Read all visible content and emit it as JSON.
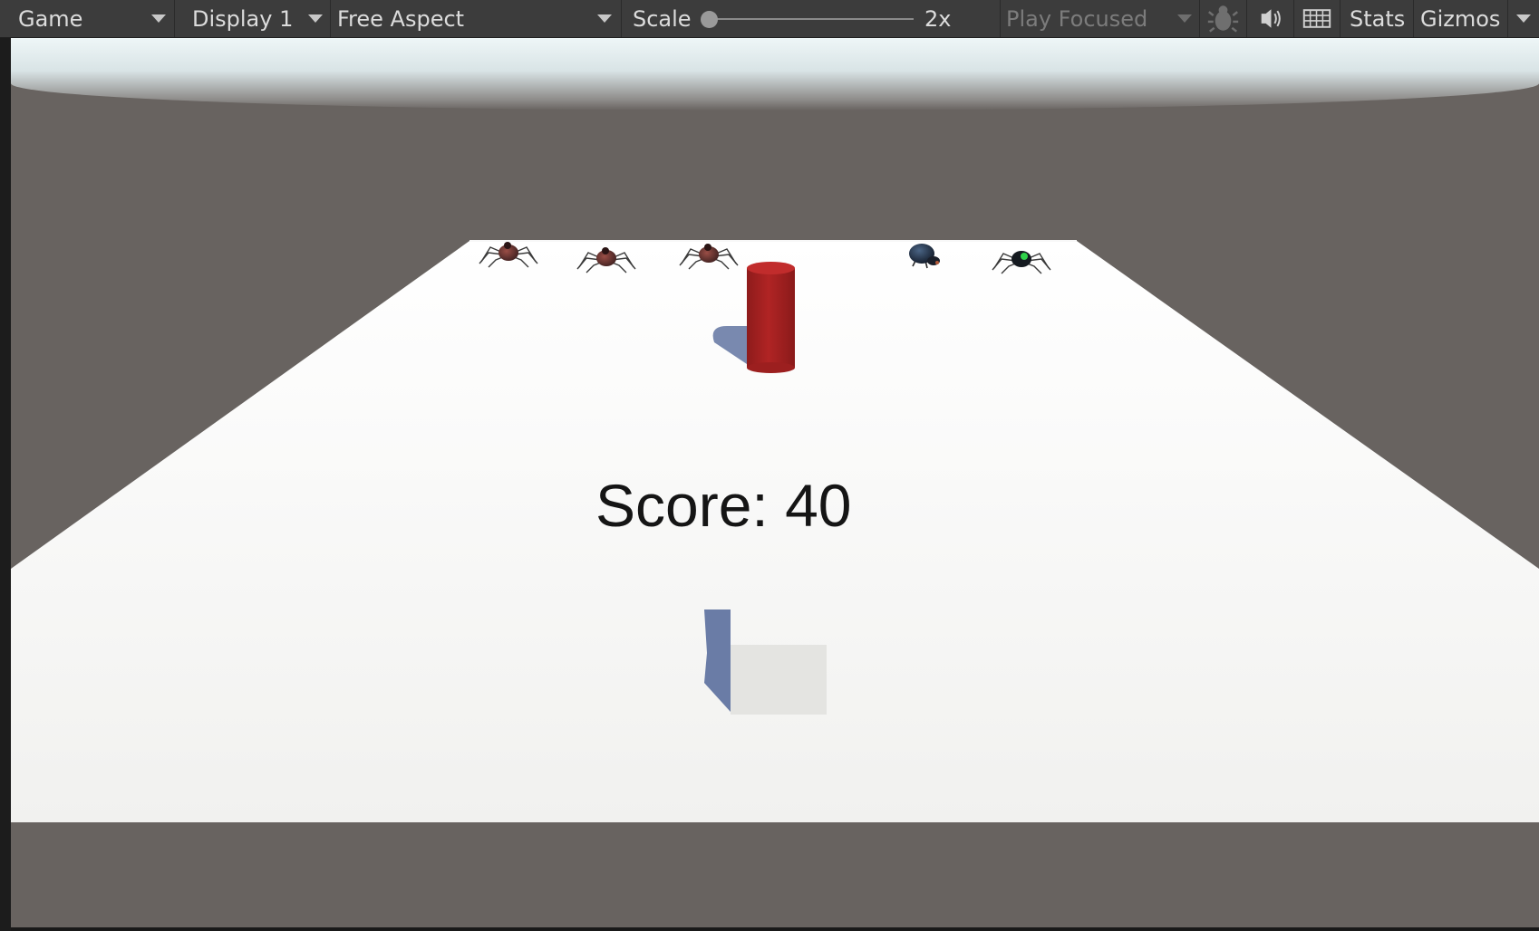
{
  "toolbar": {
    "view_label": "Game",
    "display_label": "Display 1",
    "aspect_label": "Free Aspect",
    "scale_label": "Scale",
    "scale_value": "2x",
    "scale_level": 0.0,
    "play_mode_label": "Play Focused",
    "stats_label": "Stats",
    "gizmos_label": "Gizmos",
    "icons": [
      "bug-icon",
      "speaker-icon",
      "keyboard-icon"
    ]
  },
  "game": {
    "score_text": "Score: 40",
    "enemies": [
      "red spider",
      "red spider",
      "red spider",
      "dark beetle",
      "dark spider with green spot"
    ],
    "colors": {
      "floor": "#f4f4f2",
      "ground": "#686360",
      "cylinder": "#a42020",
      "shadow": "#6a7ca6"
    }
  }
}
